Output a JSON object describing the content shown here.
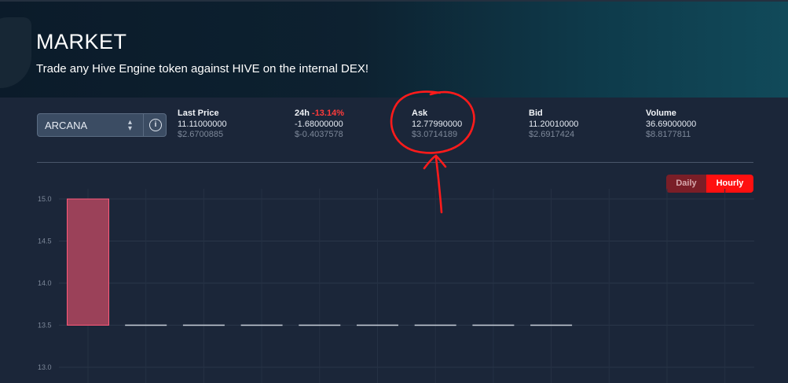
{
  "header": {
    "title": "MARKET",
    "subtitle": "Trade any Hive Engine token against HIVE on the internal DEX!"
  },
  "token_select": {
    "value": "ARCANA"
  },
  "stats": {
    "last_price": {
      "label": "Last Price",
      "value": "11.11000000",
      "usd": "$2.6700885"
    },
    "change_24h": {
      "label": "24h",
      "percent": "-13.14%",
      "value": "-1.68000000",
      "usd": "$-0.4037578"
    },
    "ask": {
      "label": "Ask",
      "value": "12.77990000",
      "usd": "$3.0714189"
    },
    "bid": {
      "label": "Bid",
      "value": "11.20010000",
      "usd": "$2.6917424"
    },
    "volume": {
      "label": "Volume",
      "value": "36.69000000",
      "usd": "$8.8177811"
    }
  },
  "interval_toggle": {
    "daily": "Daily",
    "hourly": "Hourly",
    "active": "hourly"
  },
  "colors": {
    "accent": "#ff1010",
    "negative": "#ff3b3b",
    "candle_fill": "#9b4159",
    "candle_border": "#ff5a7a"
  },
  "chart_data": {
    "type": "bar",
    "ylim": [
      12.9,
      15.0
    ],
    "yticks": [
      "15.0",
      "14.5",
      "14.0",
      "13.5",
      "13.0"
    ],
    "candles": [
      {
        "low": 13.5,
        "high": 15.0
      },
      {
        "low": 13.5,
        "high": 13.5
      },
      {
        "low": 13.5,
        "high": 13.5
      },
      {
        "low": 13.5,
        "high": 13.5
      },
      {
        "low": 13.5,
        "high": 13.5
      },
      {
        "low": 13.5,
        "high": 13.5
      },
      {
        "low": 13.5,
        "high": 13.5
      },
      {
        "low": 13.5,
        "high": 13.5
      },
      {
        "low": 13.5,
        "high": 13.5
      }
    ]
  }
}
